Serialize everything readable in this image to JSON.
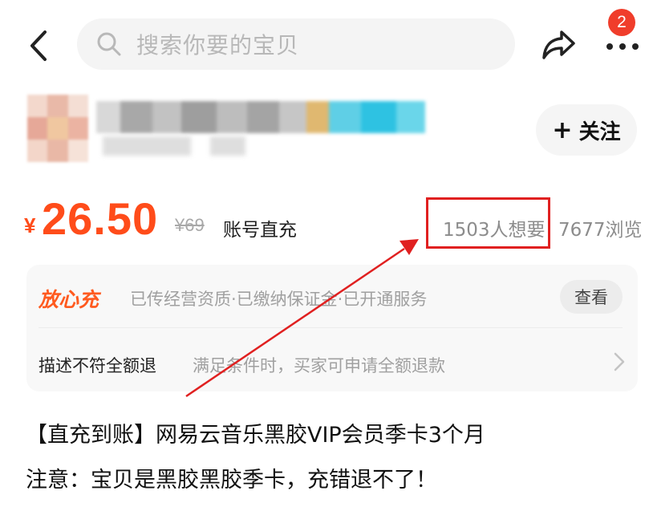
{
  "header": {
    "search_placeholder": "搜索你要的宝贝",
    "notification_count": "2"
  },
  "seller": {
    "follow_label": "关注",
    "follow_icon": "+"
  },
  "price": {
    "currency": "¥",
    "current": "26.50",
    "original": "¥69",
    "delivery_type": "账号直充",
    "wants": "1503人想要",
    "views": "7677浏览",
    "accent_color": "#ff4c1a"
  },
  "guarantee": {
    "brand": "放心充",
    "services": "已传经营资质·已缴纳保证金·已开通服务",
    "view_label": "查看",
    "refund_title": "描述不符全额退",
    "refund_desc": "满足条件时，买家可申请全额退款"
  },
  "item": {
    "title": "【直充到账】网易云音乐黑胶VIP会员季卡3个月",
    "note": "注意：宝贝是黑胶黑胶季卡，充错退不了！"
  },
  "annotation": {
    "color": "#e02020"
  }
}
